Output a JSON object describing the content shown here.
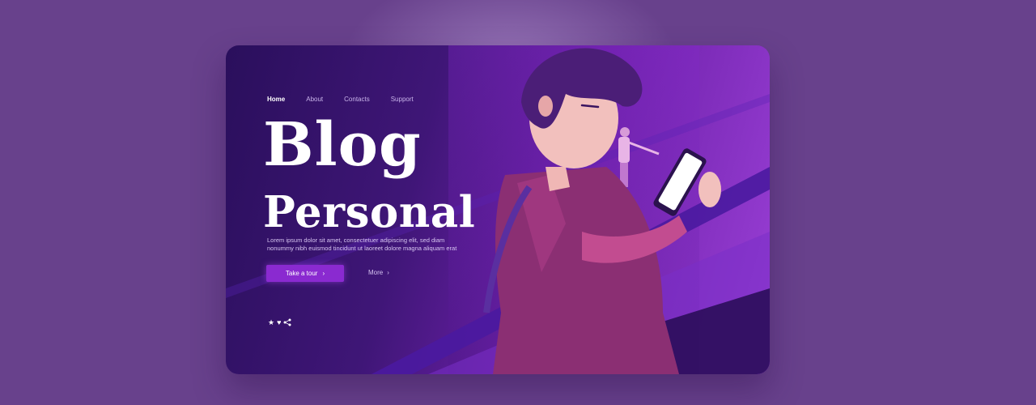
{
  "nav": [
    {
      "label": "Home",
      "active": true
    },
    {
      "label": "About"
    },
    {
      "label": "Contacts"
    },
    {
      "label": "Support"
    }
  ],
  "hero": {
    "title_line1": "Blog",
    "title_line2": "Personal",
    "description": "Lorem ipsum dolor sit amet, consectetuer adipiscing elit, sed diam nonummy nibh euismod tincidunt ut laoreet dolore magna aliquam erat"
  },
  "buttons": {
    "tour_label": "Take a tour",
    "tour_chevron": "›",
    "more_label": "More",
    "more_chevron": "›"
  },
  "social_icons": {
    "star": "★",
    "heart": "♥",
    "share": "⋖"
  },
  "colors": {
    "page_background": "#68418c",
    "accent": "#8a2ad0",
    "card_dark": "#2a0f5c",
    "card_light": "#9a3fd6"
  }
}
